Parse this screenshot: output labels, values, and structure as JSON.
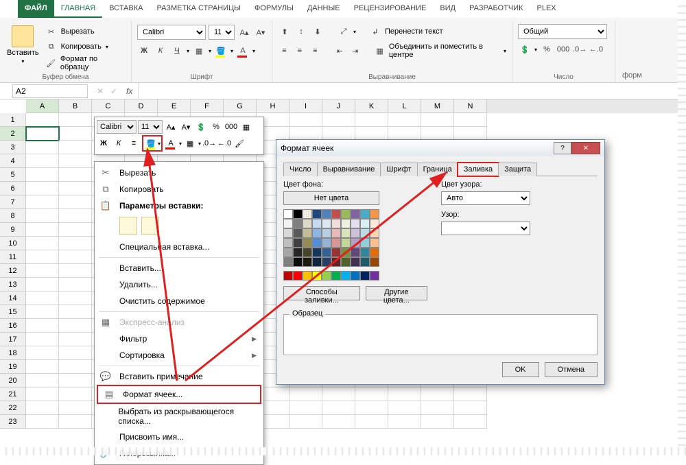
{
  "ribbon_tabs": {
    "file": "ФАЙЛ",
    "home": "ГЛАВНАЯ",
    "insert": "ВСТАВКА",
    "layout": "РАЗМЕТКА СТРАНИЦЫ",
    "formulas": "ФОРМУЛЫ",
    "data": "ДАННЫЕ",
    "review": "РЕЦЕНЗИРОВАНИЕ",
    "view": "ВИД",
    "developer": "РАЗРАБОТЧИК",
    "plex": "PLEX"
  },
  "groups": {
    "clipboard": "Буфер обмена",
    "font": "Шрифт",
    "align": "Выравнивание",
    "number": "Число"
  },
  "clipboard": {
    "paste": "Вставить",
    "cut": "Вырезать",
    "copy": "Копировать",
    "format_painter": "Формат по образцу"
  },
  "font": {
    "name": "Calibri",
    "size": "11",
    "bold": "Ж",
    "italic": "К",
    "underline": "Ч"
  },
  "align": {
    "wrap": "Перенести текст",
    "merge": "Объединить и поместить в центре"
  },
  "number": {
    "format": "Общий"
  },
  "right_cut_label": "форм",
  "namebox": "A2",
  "fx_label": "fx",
  "cols": [
    "A",
    "B",
    "C",
    "D",
    "E",
    "F",
    "G",
    "H",
    "I",
    "J",
    "K",
    "L",
    "M",
    "N"
  ],
  "rows": [
    "1",
    "2",
    "3",
    "4",
    "5",
    "6",
    "7",
    "8",
    "9",
    "10",
    "11",
    "12",
    "13",
    "14",
    "15",
    "16",
    "17",
    "18",
    "19",
    "20",
    "21",
    "22",
    "23"
  ],
  "mini": {
    "font": "Calibri",
    "size": "11"
  },
  "ctx": {
    "cut": "Вырезать",
    "copy": "Копировать",
    "paste_opts": "Параметры вставки:",
    "paste_special": "Специальная вставка...",
    "insert": "Вставить...",
    "delete": "Удалить...",
    "clear": "Очистить содержимое",
    "quick_analysis": "Экспресс-анализ",
    "filter": "Фильтр",
    "sort": "Сортировка",
    "insert_comment": "Вставить примечание",
    "format_cells": "Формат ячеек...",
    "pick_list": "Выбрать из раскрывающегося списка...",
    "define_name": "Присвоить имя...",
    "hyperlink": "Гиперссылка..."
  },
  "dlg": {
    "title": "Формат ячеек",
    "tabs": {
      "number": "Число",
      "align": "Выравнивание",
      "font": "Шрифт",
      "border": "Граница",
      "fill": "Заливка",
      "protect": "Защита"
    },
    "bg_color": "Цвет фона:",
    "no_color": "Нет цвета",
    "pattern_color": "Цвет узора:",
    "auto": "Авто",
    "pattern": "Узор:",
    "fill_effects": "Способы заливки...",
    "more_colors": "Другие цвета...",
    "sample": "Образец",
    "ok": "OK",
    "cancel": "Отмена"
  },
  "swatch_rows": [
    [
      "#ffffff",
      "#000000",
      "#eeece1",
      "#1f497d",
      "#4f81bd",
      "#c0504d",
      "#9bbb59",
      "#8064a2",
      "#4bacc6",
      "#f79646"
    ],
    [
      "#f2f2f2",
      "#7f7f7f",
      "#ddd9c4",
      "#c5d9f1",
      "#dce6f1",
      "#f2dcdb",
      "#ebf1dd",
      "#e4dfec",
      "#daeef3",
      "#fde9d9"
    ],
    [
      "#d9d9d9",
      "#595959",
      "#c4bd97",
      "#8db4e2",
      "#b8cce4",
      "#e6b8b7",
      "#d8e4bc",
      "#ccc1d9",
      "#b7dee8",
      "#fcd5b4"
    ],
    [
      "#bfbfbf",
      "#404040",
      "#948a54",
      "#538dd5",
      "#95b3d7",
      "#da9694",
      "#c4d79b",
      "#b1a0c7",
      "#92cddc",
      "#fabf8f"
    ],
    [
      "#a6a6a6",
      "#262626",
      "#494529",
      "#16365c",
      "#366092",
      "#963634",
      "#76933c",
      "#60497a",
      "#31869b",
      "#e26b0a"
    ],
    [
      "#808080",
      "#0d0d0d",
      "#1d1b10",
      "#0f243e",
      "#244062",
      "#632523",
      "#4f6228",
      "#403151",
      "#215967",
      "#974706"
    ]
  ],
  "standard_row": [
    "#c00000",
    "#ff0000",
    "#ffc000",
    "#ffff00",
    "#92d050",
    "#00b050",
    "#00b0f0",
    "#0070c0",
    "#002060",
    "#7030a0"
  ]
}
